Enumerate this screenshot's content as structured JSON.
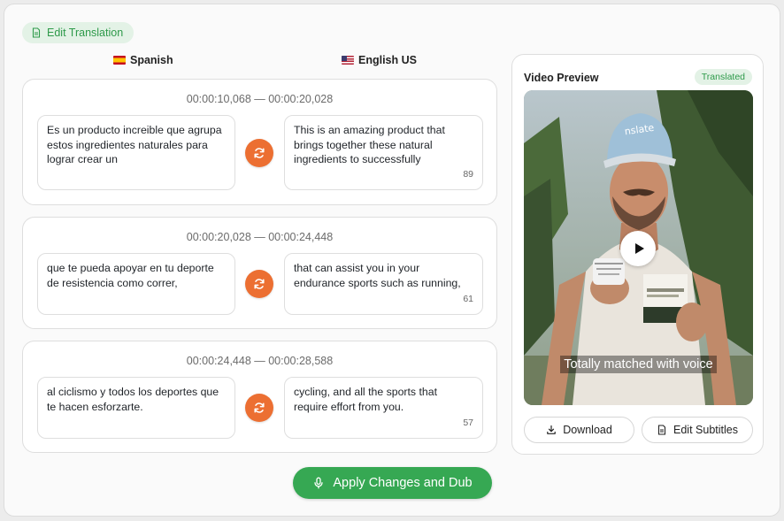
{
  "header": {
    "edit_label": "Edit Translation"
  },
  "languages": {
    "source": {
      "name": "Spanish",
      "flag": "es-flag"
    },
    "target": {
      "name": "English US",
      "flag": "us-flag"
    }
  },
  "segments": [
    {
      "timestamp": "00:00:10,068 — 00:00:20,028",
      "source": "Es un producto increible que agrupa estos ingredientes naturales para lograr crear un",
      "target": "This is an amazing product that brings together these natural ingredients to successfully",
      "count": "89"
    },
    {
      "timestamp": "00:00:20,028 — 00:00:24,448",
      "source": "que te pueda apoyar en tu deporte de resistencia como correr,",
      "target": "that can assist you in your endurance sports such as running,",
      "count": "61"
    },
    {
      "timestamp": "00:00:24,448 — 00:00:28,588",
      "source": "al ciclismo y todos los deportes que te hacen esforzarte.",
      "target": "cycling, and all the sports that require effort from you.",
      "count": "57"
    }
  ],
  "preview": {
    "title": "Video Preview",
    "status": "Translated",
    "subtitle": "Totally matched with voice",
    "download_label": "Download",
    "edit_subtitles_label": "Edit Subtitles"
  },
  "apply_label": "Apply Changes and Dub",
  "colors": {
    "accent_green": "#36a853",
    "swap_orange": "#ec6f32",
    "chip_bg": "#e3f2e6"
  }
}
